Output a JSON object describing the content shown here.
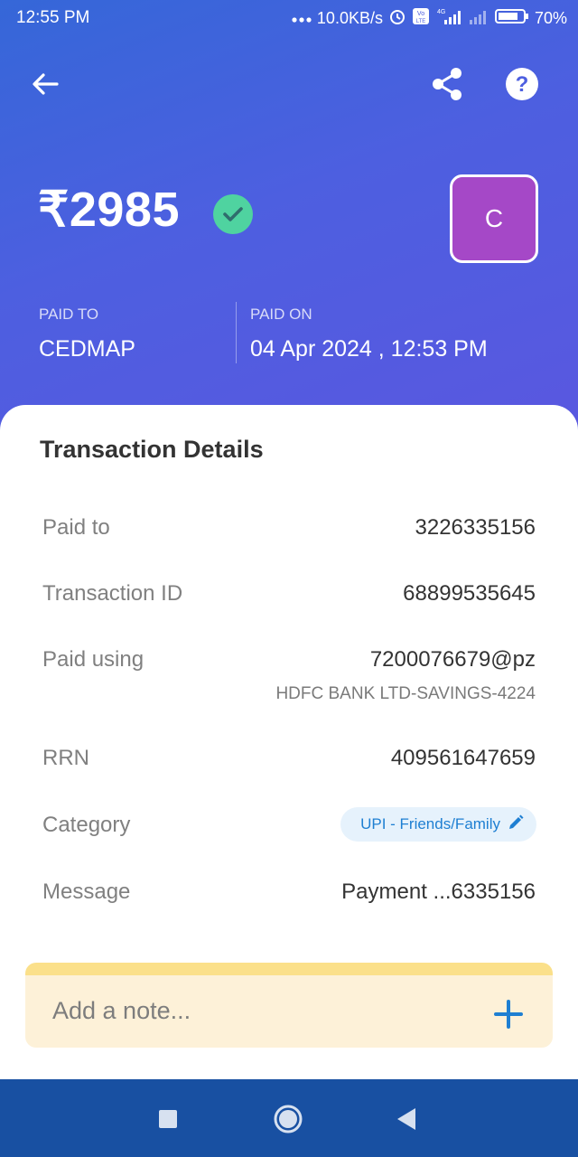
{
  "status_bar": {
    "time": "12:55 PM",
    "network_speed": "10.0KB/s",
    "battery": "70%",
    "icons": [
      "dots-icon",
      "alarm-icon",
      "volte-icon",
      "signal-4g-icon",
      "signal-icon",
      "battery-icon"
    ]
  },
  "header": {
    "amount": "₹2985",
    "avatar_letter": "C",
    "paid_to_label": "PAID TO",
    "paid_to_value": "CEDMAP",
    "paid_on_label": "PAID ON",
    "paid_on_value": "04 Apr 2024 , 12:53 PM",
    "colors": {
      "gradient_start": "#3567d8",
      "gradient_end": "#5a57e0",
      "avatar": "#a548c7",
      "check": "#4fd3a0"
    }
  },
  "details": {
    "title": "Transaction Details",
    "paid_to_label": "Paid to",
    "paid_to_value": "3226335156",
    "txn_id_label": "Transaction ID",
    "txn_id_value": "68899535645",
    "paid_using_label": "Paid using",
    "paid_using_value": "7200076679@pz",
    "paid_using_bank": "HDFC BANK LTD-SAVINGS-4224",
    "rrn_label": "RRN",
    "rrn_value": "409561647659",
    "category_label": "Category",
    "category_value": "UPI - Friends/Family",
    "message_label": "Message",
    "message_value": "Payment ...6335156"
  },
  "note": {
    "placeholder": "Add a note..."
  },
  "nav": {
    "icons": [
      "recents-icon",
      "home-icon",
      "back-icon"
    ]
  }
}
